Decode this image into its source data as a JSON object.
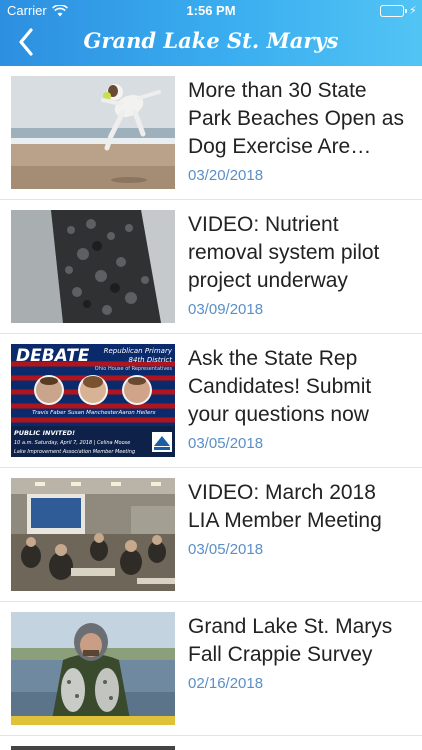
{
  "status_bar": {
    "carrier": "Carrier",
    "time": "1:56 PM"
  },
  "nav": {
    "title": "Grand Lake St. Marys"
  },
  "articles": [
    {
      "title": "More than 30 State Park Beaches Open as Dog Exercise Are…",
      "date": "03/20/2018"
    },
    {
      "title": "VIDEO: Nutrient removal system pilot project underway",
      "date": "03/09/2018"
    },
    {
      "title": "Ask the State Rep Candidates! Submit your questions now",
      "date": "03/05/2018"
    },
    {
      "title": "VIDEO: March 2018 LIA Member Meeting",
      "date": "03/05/2018"
    },
    {
      "title": "Grand Lake St. Marys Fall Crappie Survey",
      "date": "02/16/2018"
    }
  ],
  "debate_thumb": {
    "heading": "DEBATE",
    "primary": "Republican Primary",
    "district": "84th District",
    "office": "Ohio House of Representatives",
    "candidates": [
      "Travis Faber",
      "Susan Manchester",
      "Aaron Heilers"
    ],
    "invite": "PUBLIC INVITED!",
    "when": "10 a.m. Saturday, April 7, 2018 | Celina Moose",
    "host": "Lake Improvement Association Member Meeting"
  },
  "colors": {
    "nav_gradient_start": "#2d8fe0",
    "nav_gradient_end": "#52c4f4",
    "date_text": "#5a8fc7"
  }
}
